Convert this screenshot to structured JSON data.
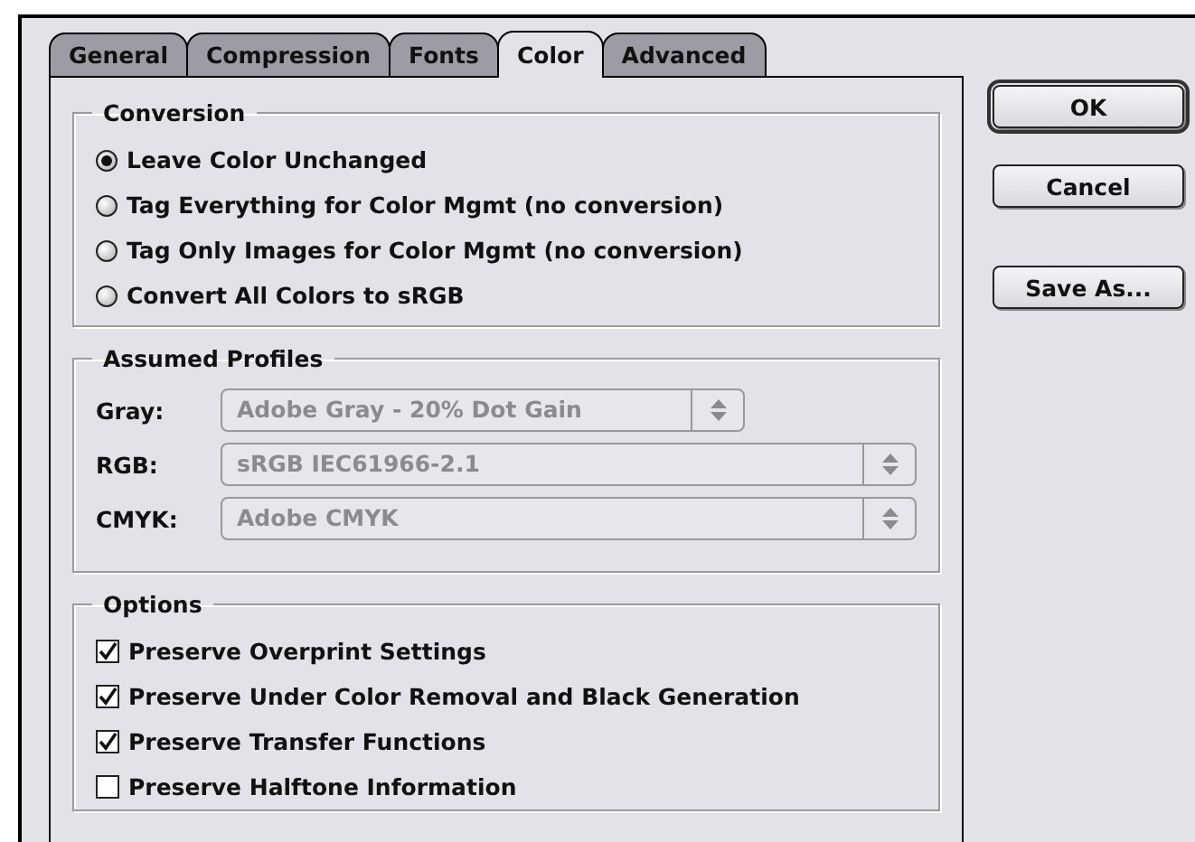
{
  "tabs": [
    {
      "label": "General",
      "selected": false
    },
    {
      "label": "Compression",
      "selected": false
    },
    {
      "label": "Fonts",
      "selected": false
    },
    {
      "label": "Color",
      "selected": true
    },
    {
      "label": "Advanced",
      "selected": false
    }
  ],
  "conversion": {
    "title": "Conversion",
    "options": [
      {
        "label": "Leave Color Unchanged",
        "selected": true
      },
      {
        "label": "Tag Everything for Color Mgmt (no conversion)",
        "selected": false
      },
      {
        "label": "Tag Only Images for Color Mgmt (no conversion)",
        "selected": false
      },
      {
        "label": "Convert All Colors to sRGB",
        "selected": false
      }
    ]
  },
  "assumed_profiles": {
    "title": "Assumed Profiles",
    "rows": [
      {
        "label": "Gray:",
        "value": "Adobe Gray - 20% Dot Gain",
        "disabled": true
      },
      {
        "label": "RGB:",
        "value": "sRGB IEC61966-2.1",
        "disabled": true
      },
      {
        "label": "CMYK:",
        "value": "Adobe CMYK",
        "disabled": true
      }
    ]
  },
  "options": {
    "title": "Options",
    "items": [
      {
        "label": "Preserve Overprint Settings",
        "checked": true
      },
      {
        "label": "Preserve Under Color Removal and Black Generation",
        "checked": true
      },
      {
        "label": "Preserve Transfer Functions",
        "checked": true
      },
      {
        "label": "Preserve Halftone Information",
        "checked": false
      }
    ]
  },
  "buttons": [
    {
      "label": "OK",
      "default": true
    },
    {
      "label": "Cancel",
      "default": false
    },
    {
      "label": "Save As...",
      "default": false
    }
  ]
}
